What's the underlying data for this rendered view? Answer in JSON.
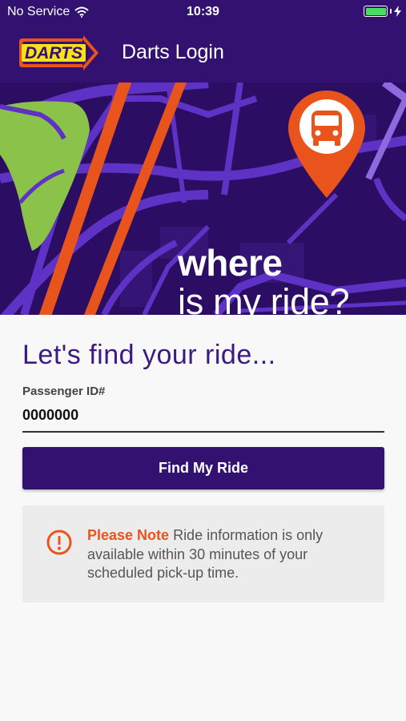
{
  "status_bar": {
    "carrier": "No Service",
    "time": "10:39"
  },
  "nav": {
    "logo_text": "DARTS",
    "title": "Darts Login"
  },
  "hero": {
    "headline_bold": "where",
    "headline_rest": "is my ride?"
  },
  "form": {
    "heading": "Let's find your ride...",
    "passenger_label": "Passenger ID#",
    "passenger_value": "0000000",
    "submit_label": "Find My Ride"
  },
  "notice": {
    "strong": "Please Note",
    "text": " Ride information is only available within 30 minutes of your scheduled pick-up time."
  },
  "colors": {
    "header": "#331170",
    "accent": "#e8541c",
    "map_green": "#8bc34a"
  }
}
